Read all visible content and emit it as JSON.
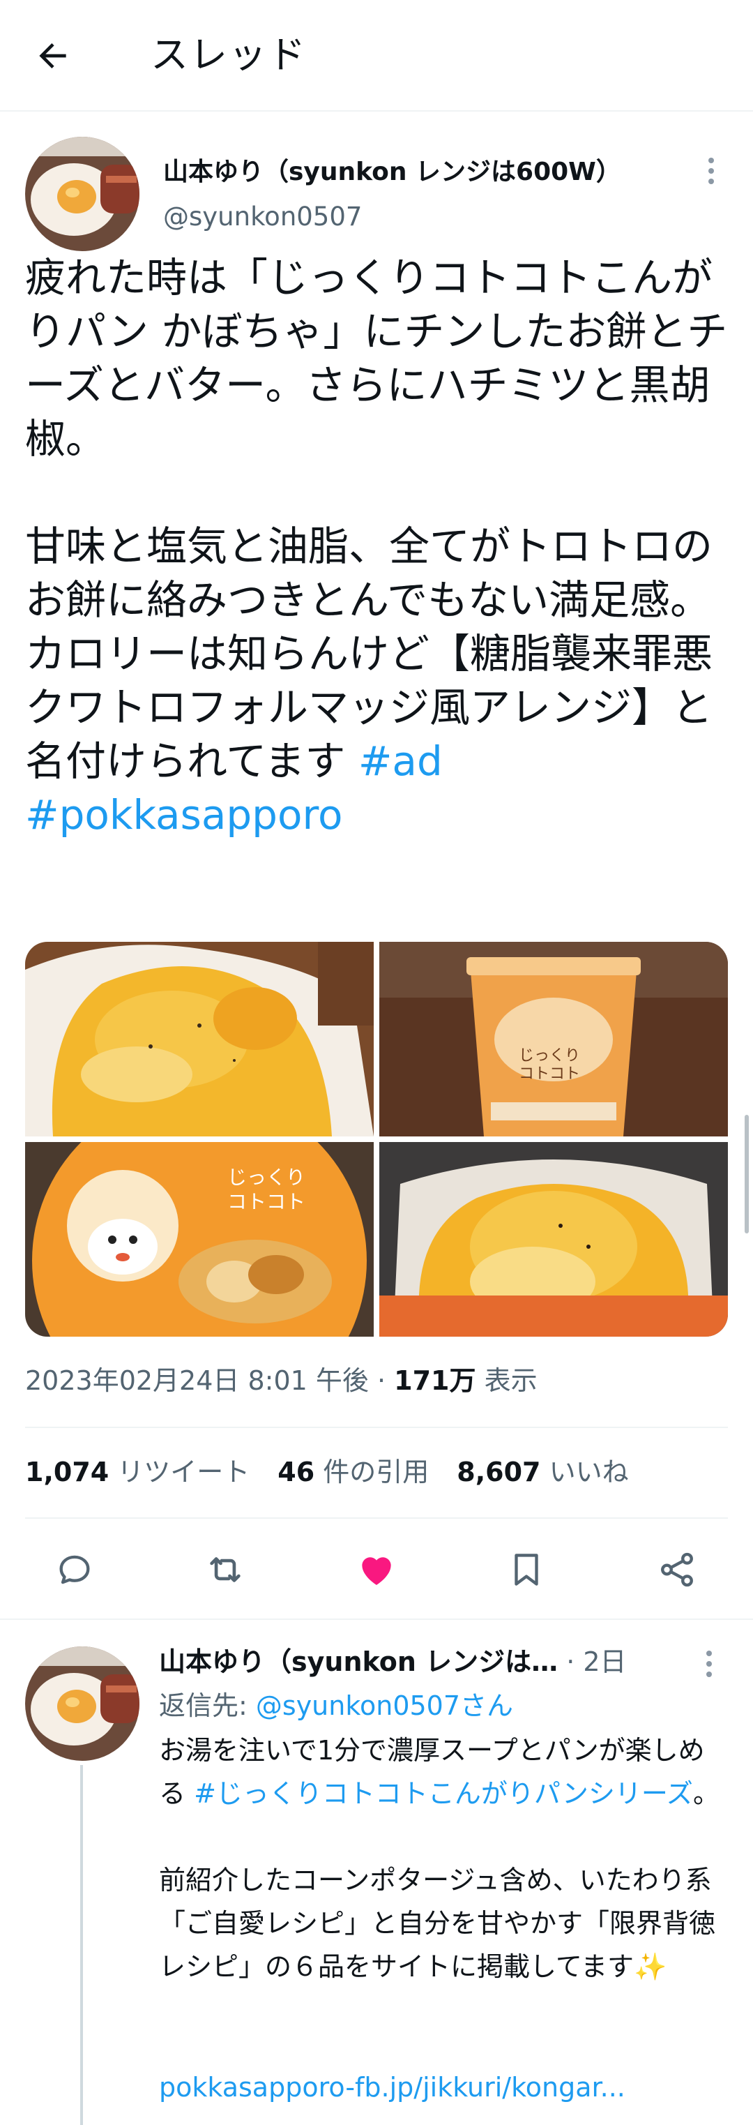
{
  "header": {
    "title": "スレッド",
    "back_icon": "arrow-left-icon"
  },
  "tweet": {
    "author_name": "山本ゆり（syunkon レンジは600W）",
    "handle": "@syunkon0507",
    "text_main": "疲れた時は「じっくりコトコトこんがりパン かぼちゃ」にチンしたお餅とチーズとバター。さらにハチミツと黒胡椒。\n\n甘味と塩気と油脂、全てがトロトロのお餅に絡みつきとんでもない満足感。カロリーは知らんけど【糖脂襲来罪悪クワトロフォルマッジ風アレンジ】と名付けられてます ",
    "hashtag_1": "#ad",
    "hashtag_2": "#pokkasapporo",
    "timestamp": "2023年02月24日 8:01 午後 · ",
    "views_count": "171万",
    "views_label": " 表示",
    "retweets_count": "1,074",
    "retweets_label": " リツイート",
    "quotes_count": "46",
    "quotes_label": " 件の引用",
    "likes_count": "8,607",
    "likes_label": " いいね",
    "media": [
      {
        "name": "photo-pumpkin-soup-bowl"
      },
      {
        "name": "photo-product-cup"
      },
      {
        "name": "photo-product-lid"
      },
      {
        "name": "photo-mochi-cheese"
      }
    ]
  },
  "reply": {
    "author_name": "山本ゆり（syunkon レンジは…",
    "time": " · 2日",
    "reply_to_label": "返信先: ",
    "reply_to_mention": "@syunkon0507さん",
    "text_part1": "お湯を注いで1分で濃厚スープとパンが楽しめる ",
    "hashtag": "#じっくりコトコトこんがりパンシリーズ",
    "text_part2": "。\n\n前紹介したコーンポタージュ含め、いたわり系「ご自愛レシピ」と自分を甘やかす「限界背徳レシピ」の６品をサイトに掲載してます✨",
    "link": "pokkasapporo-fb.jp/jikkuri/kongar..."
  },
  "colors": {
    "accent": "#1d9bf0",
    "like": "#f91880",
    "text": "#0f1419",
    "muted": "#536471"
  }
}
